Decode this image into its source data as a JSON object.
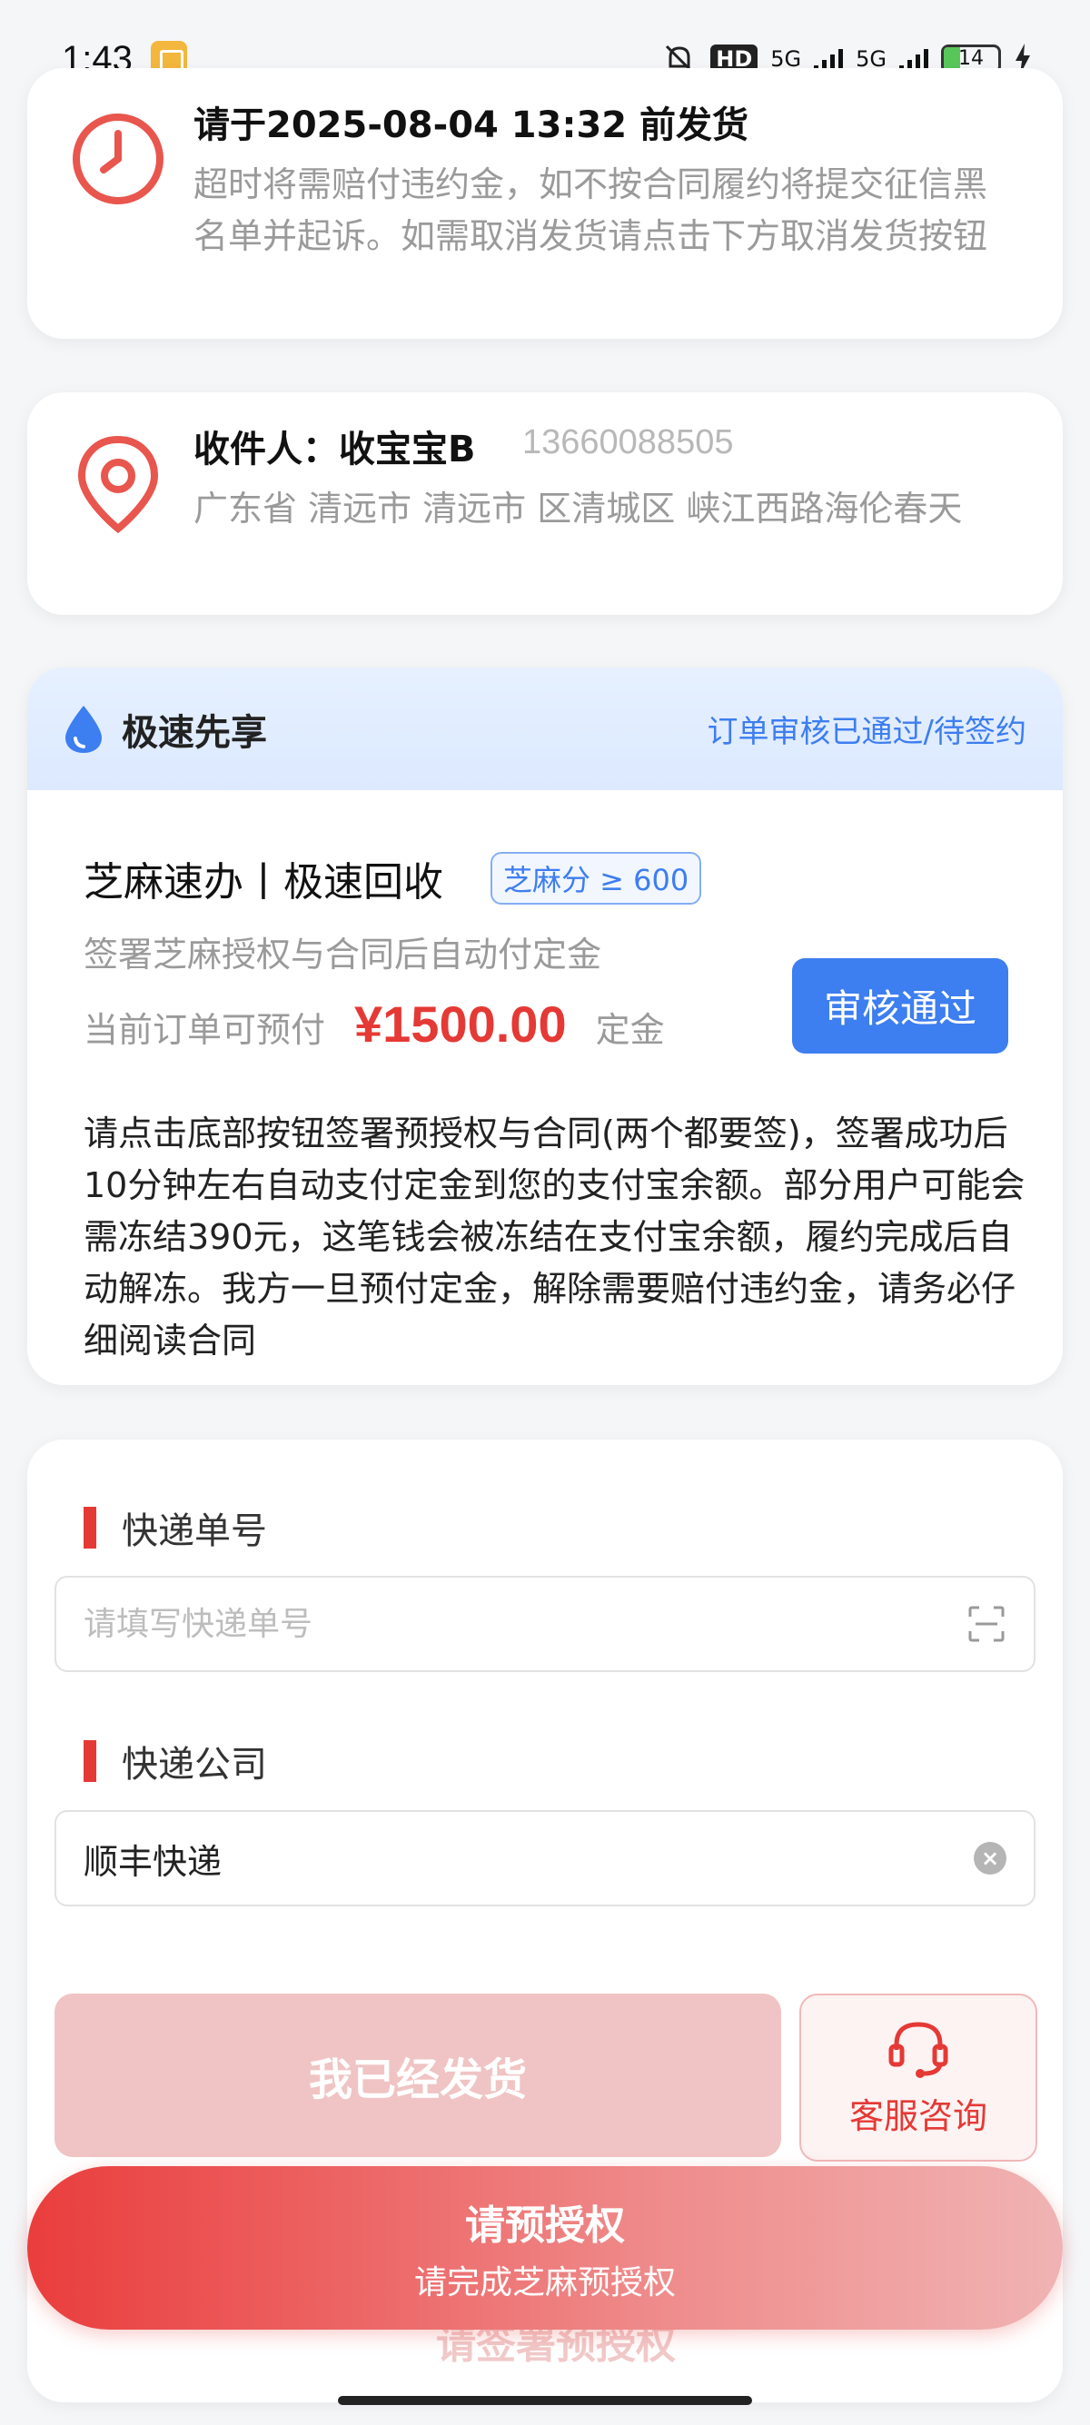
{
  "status_bar": {
    "time": "1:43",
    "hd_label": "HD",
    "network_1": "5G",
    "network_2": "5G",
    "battery": "14"
  },
  "deadline": {
    "title": "请于2025-08-04 13:32 前发货",
    "description": "超时将需赔付违约金，如不按合同履约将提交征信黑名单并起诉。如需取消发货请点击下方取消发货按钮"
  },
  "address": {
    "recipient": "收件人：收宝宝B",
    "phone": "13660088505",
    "detail": "广东省 清远市 清远市 区清城区 峡江西路海伦春天"
  },
  "express": {
    "title": "极速先享",
    "status": "订单审核已通过/待签约",
    "service_title": "芝麻速办丨极速回收",
    "tag": "芝麻分 ≥ 600",
    "subtitle": "签署芝麻授权与合同后自动付定金",
    "prepay_label": "当前订单可预付",
    "amount": "¥1500.00",
    "amount_unit": "定金",
    "approve_button": "审核通过",
    "notice": "请点击底部按钮签署预授权与合同(两个都要签)，签署成功后10分钟左右自动支付定金到您的支付宝余额。部分用户可能会需冻结390元，这笔钱会被冻结在支付宝余额，履约完成后自动解冻。我方一旦预付定金，解除需要赔付违约金，请务必仔细阅读合同"
  },
  "form": {
    "tracking_label": "快递单号",
    "tracking_placeholder": "请填写快递单号",
    "tracking_value": "",
    "company_label": "快递公司",
    "company_value": "顺丰快递",
    "shipped_button": "我已经发货",
    "service_button": "客服咨询",
    "ghost_text": "请签署预授权"
  },
  "bottom_cta": {
    "main": "请预授权",
    "sub": "请完成芝麻预授权"
  },
  "colors": {
    "accent_red": "#e53935",
    "accent_blue": "#3d7ef0"
  },
  "icons": [
    "clock-icon",
    "location-pin-icon",
    "droplet-icon",
    "scan-icon",
    "clear-icon",
    "headset-icon"
  ]
}
